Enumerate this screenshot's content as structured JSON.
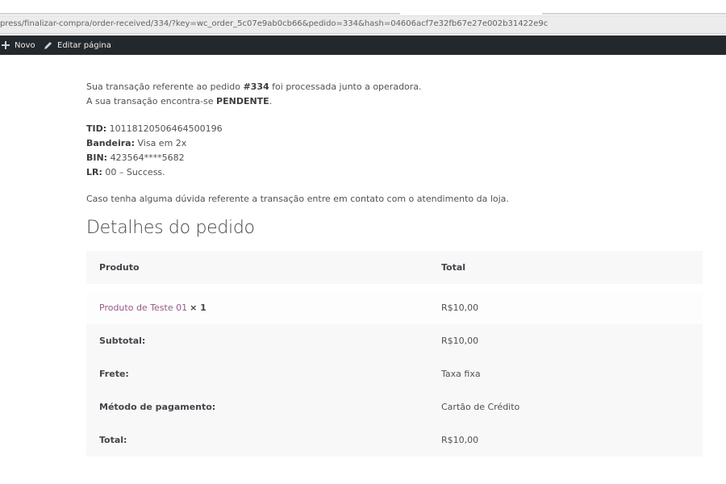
{
  "browser": {
    "url": "press/finalizar-compra/order-received/334/?key=wc_order_5c07e9ab0cb66&pedido=334&hash=04606acf7e32fb67e27e002b31422e9c"
  },
  "admin_bar": {
    "new_label": "Novo",
    "edit_label": "Editar página"
  },
  "notice": {
    "line1_pre": "Sua transação referente ao pedido ",
    "order_number": "#334",
    "line1_post": " foi processada junto a operadora.",
    "line2_pre": "A sua transação encontra-se ",
    "status": "PENDENTE",
    "line2_post": "."
  },
  "transaction": {
    "tid_label": "TID:",
    "tid_value": " 10118120506464500196",
    "brand_label": "Bandeira:",
    "brand_value": " Visa em 2x",
    "bin_label": "BIN:",
    "bin_value": " 423564****5682",
    "lr_label": "LR:",
    "lr_value": " 00 – Success."
  },
  "help_text": "Caso tenha alguma dúvida referente a transação entre em contato com o atendimento da loja.",
  "order_details": {
    "heading": "Detalhes do pedido",
    "col_product": "Produto",
    "col_total": "Total",
    "item_name": "Produto de Teste 01",
    "item_qty": "× 1",
    "item_total": "R$10,00",
    "subtotal_label": "Subtotal:",
    "subtotal_value": "R$10,00",
    "shipping_label": "Frete:",
    "shipping_value": "Taxa fixa",
    "payment_label": "Método de pagamento:",
    "payment_value": "Cartão de Crédito",
    "total_label": "Total:",
    "total_value": "R$10,00"
  },
  "colors": {
    "admin_bar_bg": "#23282d",
    "link": "#96588a",
    "row_shaded": "#f8f8f8",
    "row_plain": "#fdfdfd"
  },
  "icons": [
    "plus-icon",
    "pencil-icon"
  ]
}
